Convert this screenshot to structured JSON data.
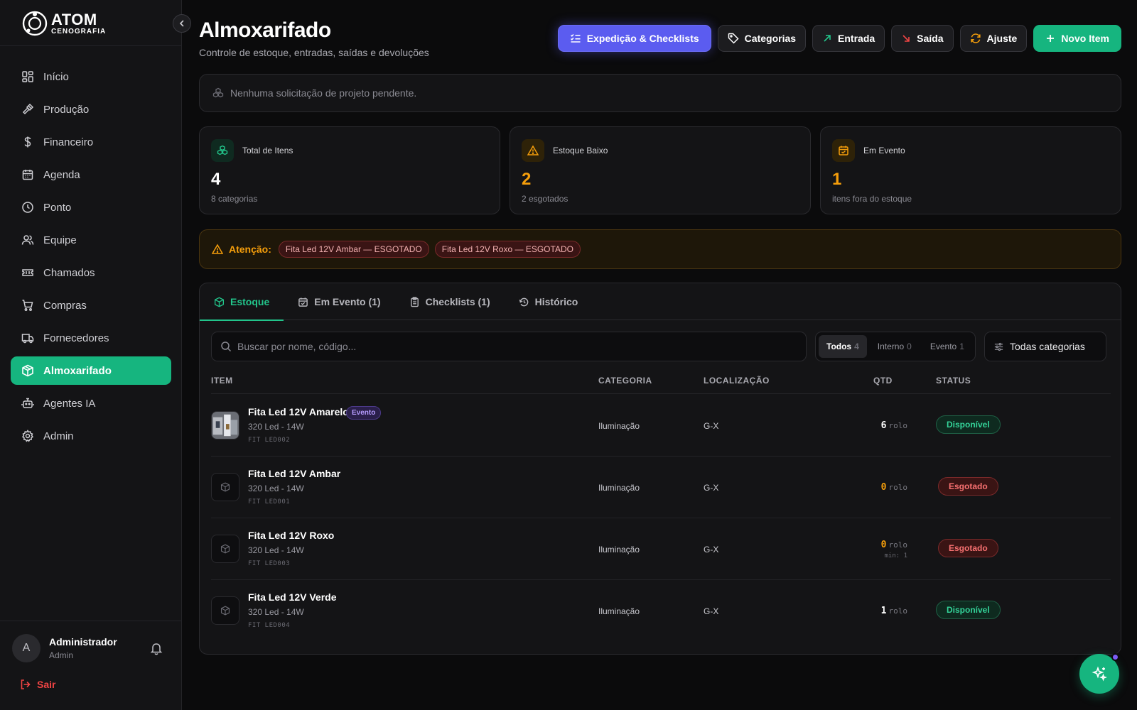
{
  "brand": {
    "name": "ATOM",
    "sub": "CENOGRAFIA"
  },
  "sidebar": {
    "items": [
      {
        "label": "Início",
        "icon": "grid-icon"
      },
      {
        "label": "Produção",
        "icon": "hammer-icon"
      },
      {
        "label": "Financeiro",
        "icon": "dollar-icon"
      },
      {
        "label": "Agenda",
        "icon": "calendar-icon"
      },
      {
        "label": "Ponto",
        "icon": "clock-icon"
      },
      {
        "label": "Equipe",
        "icon": "users-icon"
      },
      {
        "label": "Chamados",
        "icon": "ticket-icon"
      },
      {
        "label": "Compras",
        "icon": "cart-icon"
      },
      {
        "label": "Fornecedores",
        "icon": "truck-icon"
      },
      {
        "label": "Almoxarifado",
        "icon": "box-icon",
        "active": true
      },
      {
        "label": "Agentes IA",
        "icon": "bot-icon"
      },
      {
        "label": "Admin",
        "icon": "gear-icon"
      }
    ]
  },
  "user": {
    "initial": "A",
    "name": "Administrador",
    "role": "Admin",
    "logout": "Sair"
  },
  "header": {
    "title": "Almoxarifado",
    "subtitle": "Controle de estoque, entradas, saídas e devoluções",
    "actions": {
      "expedicao": "Expedição & Checklists",
      "categorias": "Categorias",
      "entrada": "Entrada",
      "saida": "Saída",
      "ajuste": "Ajuste",
      "novo": "Novo Item"
    }
  },
  "notice": "Nenhuma solicitação de projeto pendente.",
  "stats": [
    {
      "label": "Total de Itens",
      "value": "4",
      "note": "8 categorias",
      "color": "#ffffff",
      "accent": "#22c58b"
    },
    {
      "label": "Estoque Baixo",
      "value": "2",
      "note": "2 esgotados",
      "color": "#f59e0b",
      "accent": "#f59e0b"
    },
    {
      "label": "Em Evento",
      "value": "1",
      "note": "itens fora do estoque",
      "color": "#f59e0b",
      "accent": "#f59e0b"
    }
  ],
  "alert": {
    "title": "Atenção:",
    "chips": [
      "Fita Led 12V Ambar — ESGOTADO",
      "Fita Led 12V Roxo — ESGOTADO"
    ]
  },
  "tabs": [
    {
      "label": "Estoque",
      "active": true
    },
    {
      "label": "Em Evento (1)"
    },
    {
      "label": "Checklists (1)"
    },
    {
      "label": "Histórico"
    }
  ],
  "toolbar": {
    "search_placeholder": "Buscar por nome, código...",
    "filters": [
      {
        "label": "Todos",
        "count": "4",
        "active": true
      },
      {
        "label": "Interno",
        "count": "0"
      },
      {
        "label": "Evento",
        "count": "1"
      }
    ],
    "category": "Todas categorias"
  },
  "table": {
    "headers": {
      "item": "ITEM",
      "categoria": "CATEGORIA",
      "localizacao": "LOCALIZAÇÃO",
      "qtd": "QTD",
      "status": "STATUS"
    },
    "rows": [
      {
        "name": "Fita Led 12V Amarelo",
        "badge": "Evento",
        "desc": "320 Led - 14W",
        "code": "FIT LED002",
        "categoria": "Iluminação",
        "local": "G-X",
        "qtd": "6",
        "unit": "rolo",
        "min": "",
        "status": "Disponível",
        "status_type": "ok",
        "qty_color": "#ffffff",
        "photo": true
      },
      {
        "name": "Fita Led 12V Ambar",
        "badge": "",
        "desc": "320 Led - 14W",
        "code": "FIT LED001",
        "categoria": "Iluminação",
        "local": "G-X",
        "qtd": "0",
        "unit": "rolo",
        "min": "",
        "status": "Esgotado",
        "status_type": "out",
        "qty_color": "#f59e0b",
        "photo": false
      },
      {
        "name": "Fita Led 12V Roxo",
        "badge": "",
        "desc": "320 Led - 14W",
        "code": "FIT LED003",
        "categoria": "Iluminação",
        "local": "G-X",
        "qtd": "0",
        "unit": "rolo",
        "min": "min: 1",
        "status": "Esgotado",
        "status_type": "out",
        "qty_color": "#f59e0b",
        "photo": false
      },
      {
        "name": "Fita Led 12V Verde",
        "badge": "",
        "desc": "320 Led - 14W",
        "code": "FIT LED004",
        "categoria": "Iluminação",
        "local": "G-X",
        "qtd": "1",
        "unit": "rolo",
        "min": "",
        "status": "Disponível",
        "status_type": "ok",
        "qty_color": "#ffffff",
        "photo": false
      }
    ]
  }
}
